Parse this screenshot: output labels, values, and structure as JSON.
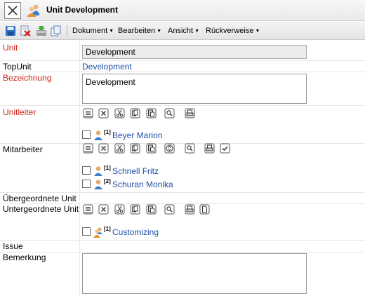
{
  "title": "Unit Development",
  "menus": [
    "Dokument",
    "Bearbeiten",
    "Ansicht",
    "Rückverweise"
  ],
  "labels": {
    "unit": "Unit",
    "topunit": "TopUnit",
    "bezeichnung": "Bezeichnung",
    "unitleiter": "Unitleiter",
    "mitarbeiter": "Mitarbeiter",
    "uebergeordnete": "Übergeordnete Unit",
    "untergeordnete": "Untergeordnete Unit",
    "issue": "Issue",
    "bemerkung": "Bemerkung"
  },
  "fields": {
    "unit": "Development",
    "topunit": "Development",
    "bezeichnung": "Development",
    "bemerkung": ""
  },
  "unitleiter": [
    {
      "badge": "[1]",
      "name": "Beyer Marion"
    }
  ],
  "mitarbeiter": [
    {
      "badge": "[1]",
      "name": "Schnell Fritz"
    },
    {
      "badge": "[2]",
      "name": "Schuran Monika"
    }
  ],
  "untergeordnete": [
    {
      "badge": "[1]",
      "name": "Customizing"
    }
  ],
  "colors": {
    "required_label": "#c8281e",
    "link": "#1f4fa8"
  }
}
